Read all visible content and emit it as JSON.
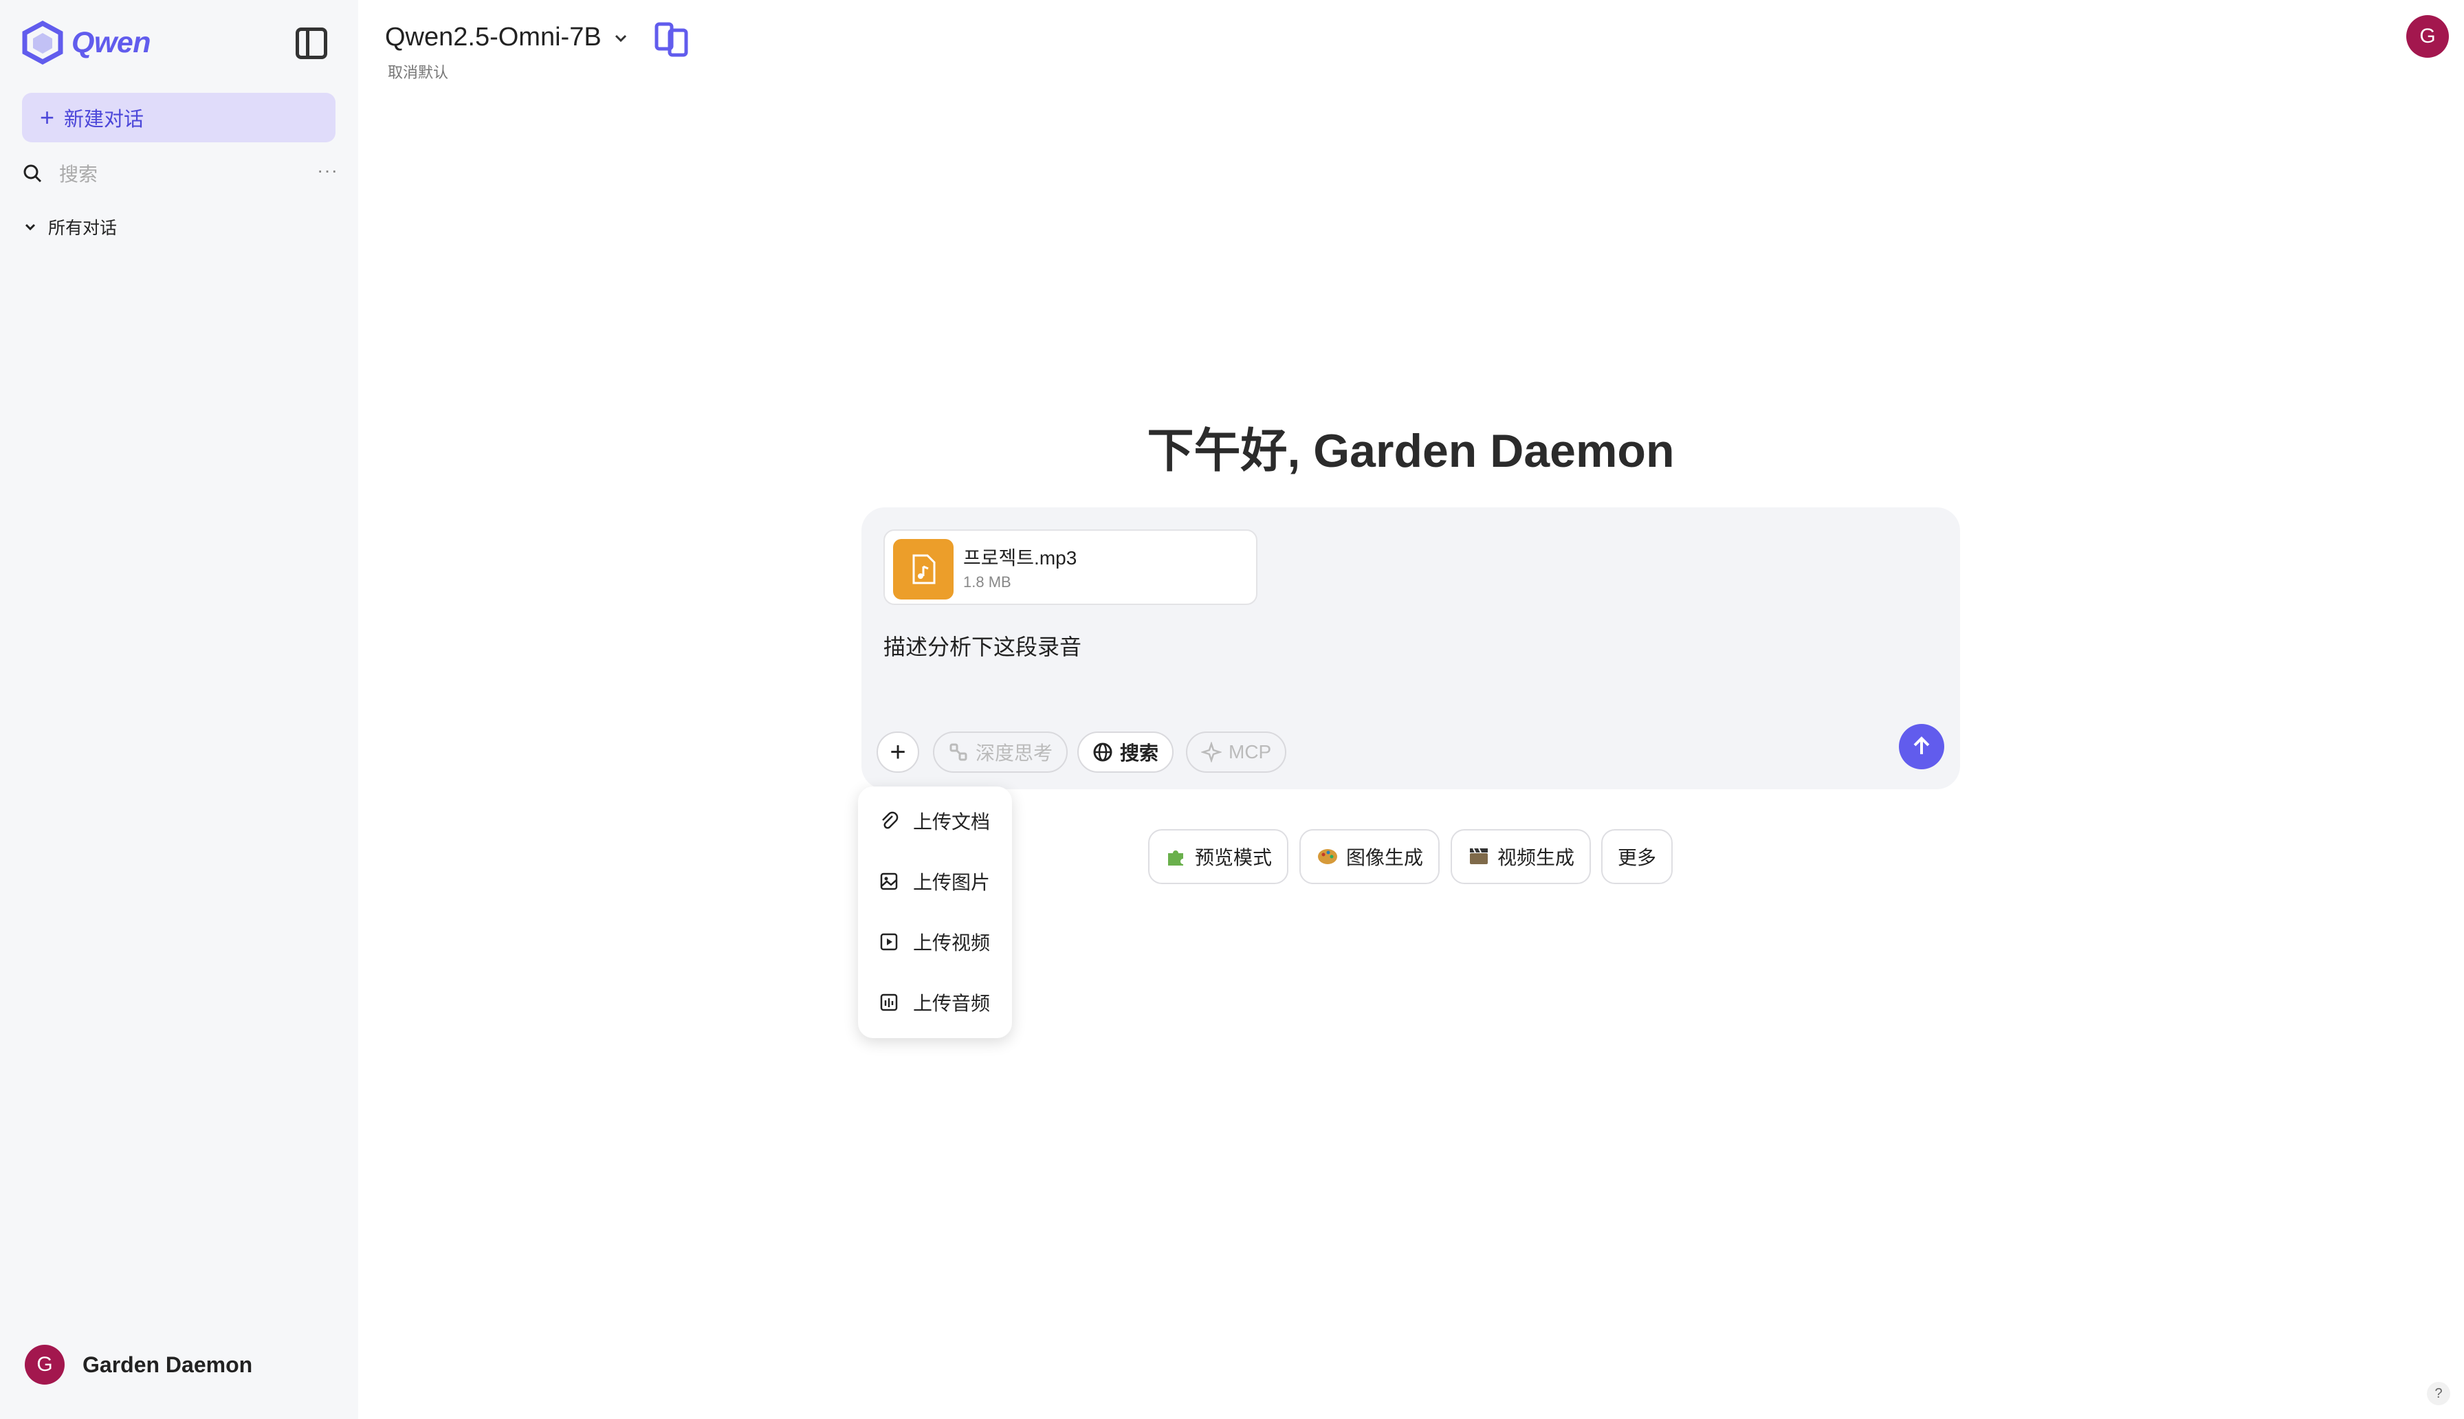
{
  "sidebar": {
    "logo_text": "Qwen",
    "new_chat_label": "新建对话",
    "search_placeholder": "搜索",
    "more_label": "···",
    "all_conversations_label": "所有对话",
    "user": {
      "avatar_letter": "G",
      "name": "Garden Daemon"
    }
  },
  "header": {
    "model_name": "Qwen2.5-Omni-7B",
    "model_subtext": "取消默认",
    "avatar_letter": "G"
  },
  "main": {
    "greeting": "下午好, Garden Daemon",
    "attachment": {
      "file_name": "프로젝트.mp3",
      "file_size": "1.8 MB",
      "icon": "music-file-icon"
    },
    "prompt_text": "描述分析下这段录音",
    "toolbar": {
      "plus_label": "+",
      "deep_thinking_label": "深度思考",
      "search_label": "搜索",
      "mcp_label": "MCP"
    },
    "upload_menu": [
      {
        "label": "上传文档",
        "icon": "paperclip-icon"
      },
      {
        "label": "上传图片",
        "icon": "image-icon"
      },
      {
        "label": "上传视频",
        "icon": "video-icon"
      },
      {
        "label": "上传音频",
        "icon": "audio-icon"
      }
    ],
    "suggestions": [
      {
        "label": "预览模式",
        "icon": "puzzle-icon"
      },
      {
        "label": "图像生成",
        "icon": "palette-icon"
      },
      {
        "label": "视频生成",
        "icon": "film-icon"
      },
      {
        "label": "更多"
      }
    ]
  },
  "help_label": "?",
  "colors": {
    "accent": "#615ced",
    "avatar": "#a3174e",
    "file_icon": "#ec9e2a",
    "new_chat_bg": "#e0dcfa"
  }
}
